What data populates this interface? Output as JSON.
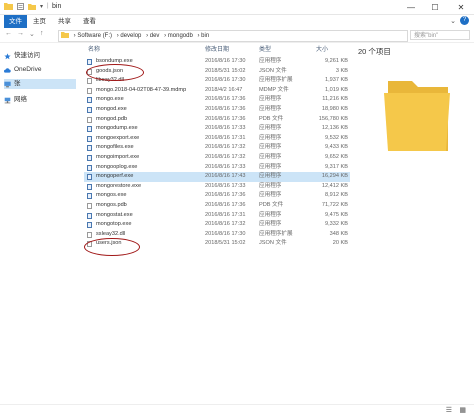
{
  "window": {
    "title": "bin"
  },
  "ribbon": {
    "tabs": [
      "文件",
      "主页",
      "共享",
      "查看"
    ]
  },
  "nav": {
    "back": "←",
    "forward": "→",
    "up_history": "⌄",
    "up": "↑"
  },
  "address": {
    "path": [
      "Software (F:)",
      "develop",
      "dev",
      "mongodb",
      "bin"
    ],
    "separator": "›"
  },
  "search": {
    "placeholder": "搜索\"bin\""
  },
  "sidebar": {
    "items": [
      {
        "label": "快速访问",
        "icon": "star-icon"
      },
      {
        "label": "OneDrive",
        "icon": "cloud-icon"
      },
      {
        "label": "张",
        "icon": "user-icon"
      },
      {
        "label": "网络",
        "icon": "network-icon"
      }
    ]
  },
  "file_list": {
    "columns": {
      "name": "名称",
      "date": "修改日期",
      "type": "类型",
      "size": "大小"
    },
    "rows": [
      {
        "name": "bsondump.exe",
        "date": "2016/8/16 17:30",
        "type": "应用程序",
        "size": "9,261 KB",
        "kind": "exe"
      },
      {
        "name": "goods.json",
        "date": "2018/5/31 15:02",
        "type": "JSON 文件",
        "size": "3 KB",
        "kind": "file"
      },
      {
        "name": "libeay32.dll",
        "date": "2016/8/16 17:30",
        "type": "应用程序扩展",
        "size": "1,937 KB",
        "kind": "file"
      },
      {
        "name": "mongo.2018-04-02T08-47-39.mdmp",
        "date": "2018/4/2 16:47",
        "type": "MDMP 文件",
        "size": "1,019 KB",
        "kind": "file"
      },
      {
        "name": "mongo.exe",
        "date": "2016/8/16 17:36",
        "type": "应用程序",
        "size": "11,216 KB",
        "kind": "exe"
      },
      {
        "name": "mongod.exe",
        "date": "2016/8/16 17:36",
        "type": "应用程序",
        "size": "18,980 KB",
        "kind": "exe"
      },
      {
        "name": "mongod.pdb",
        "date": "2016/8/16 17:36",
        "type": "PDB 文件",
        "size": "156,780 KB",
        "kind": "file"
      },
      {
        "name": "mongodump.exe",
        "date": "2016/8/16 17:33",
        "type": "应用程序",
        "size": "12,136 KB",
        "kind": "exe"
      },
      {
        "name": "mongoexport.exe",
        "date": "2016/8/16 17:31",
        "type": "应用程序",
        "size": "9,532 KB",
        "kind": "exe"
      },
      {
        "name": "mongofiles.exe",
        "date": "2016/8/16 17:32",
        "type": "应用程序",
        "size": "9,433 KB",
        "kind": "exe"
      },
      {
        "name": "mongoimport.exe",
        "date": "2016/8/16 17:32",
        "type": "应用程序",
        "size": "9,652 KB",
        "kind": "exe"
      },
      {
        "name": "mongooplog.exe",
        "date": "2016/8/16 17:33",
        "type": "应用程序",
        "size": "9,317 KB",
        "kind": "exe"
      },
      {
        "name": "mongoperf.exe",
        "date": "2016/8/16 17:43",
        "type": "应用程序",
        "size": "16,294 KB",
        "kind": "exe"
      },
      {
        "name": "mongorestore.exe",
        "date": "2016/8/16 17:33",
        "type": "应用程序",
        "size": "12,412 KB",
        "kind": "exe"
      },
      {
        "name": "mongos.exe",
        "date": "2016/8/16 17:36",
        "type": "应用程序",
        "size": "8,912 KB",
        "kind": "exe"
      },
      {
        "name": "mongos.pdb",
        "date": "2016/8/16 17:36",
        "type": "PDB 文件",
        "size": "71,722 KB",
        "kind": "file"
      },
      {
        "name": "mongostat.exe",
        "date": "2016/8/16 17:31",
        "type": "应用程序",
        "size": "9,475 KB",
        "kind": "exe"
      },
      {
        "name": "mongotop.exe",
        "date": "2016/8/16 17:32",
        "type": "应用程序",
        "size": "9,332 KB",
        "kind": "exe"
      },
      {
        "name": "ssleay32.dll",
        "date": "2016/8/16 17:30",
        "type": "应用程序扩展",
        "size": "348 KB",
        "kind": "file"
      },
      {
        "name": "users.json",
        "date": "2018/5/31 15:02",
        "type": "JSON 文件",
        "size": "20 KB",
        "kind": "file"
      }
    ],
    "selected_index": 12
  },
  "preview": {
    "count": "20 个项目"
  },
  "colors": {
    "accent": "#1e6fc5",
    "selection": "#cce4f7",
    "annotation": "#a11919",
    "folder": "#f5c84a"
  }
}
